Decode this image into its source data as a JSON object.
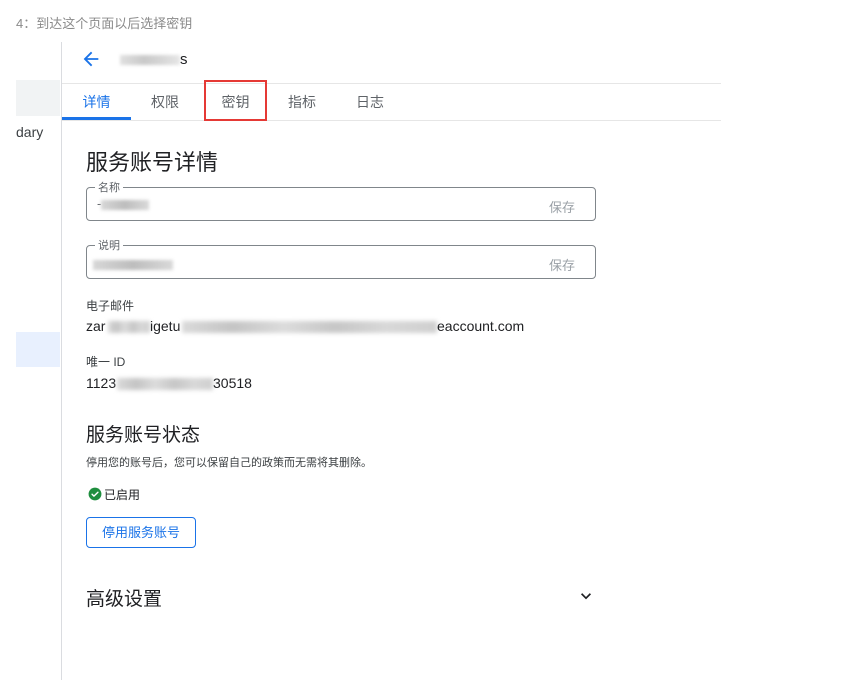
{
  "caption": "4：到达这个页面以后选择密钥",
  "left_nav": {
    "partial_text": "dary"
  },
  "header": {
    "title_tail": "s"
  },
  "tabs": [
    {
      "label": "详情",
      "active": true
    },
    {
      "label": "权限",
      "active": false
    },
    {
      "label": "密钥",
      "active": false
    },
    {
      "label": "指标",
      "active": false
    },
    {
      "label": "日志",
      "active": false
    }
  ],
  "details": {
    "heading": "服务账号详情",
    "name_field": {
      "label": "名称",
      "value_prefix": "-",
      "save_label": "保存"
    },
    "description_field": {
      "label": "说明",
      "save_label": "保存"
    },
    "email": {
      "label": "电子邮件",
      "prefix": "zar",
      "mid": "igetu",
      "suffix": "eaccount.com"
    },
    "unique_id": {
      "label": "唯一 ID",
      "prefix": "1123",
      "suffix": "30518"
    }
  },
  "status": {
    "heading": "服务账号状态",
    "description": "停用您的账号后，您可以保留自己的政策而无需将其删除。",
    "state_label": "已启用",
    "disable_button": "停用服务账号"
  },
  "advanced": {
    "heading": "高级设置"
  },
  "colors": {
    "accent": "#1a73e8",
    "success": "#1e8e3e",
    "highlight": "#e53935"
  }
}
